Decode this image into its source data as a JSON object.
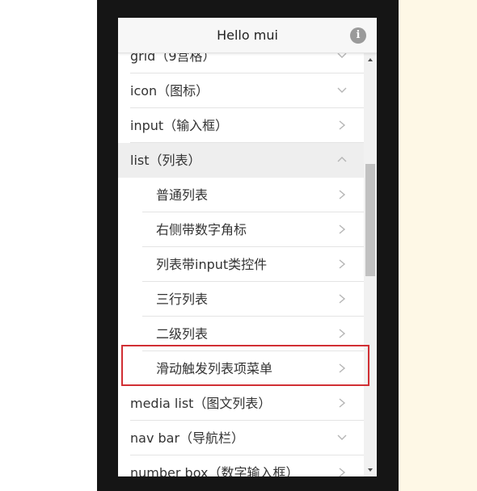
{
  "colors": {
    "phone_frame": "#151515",
    "page_right_bg": "#fef8e6",
    "highlight": "#d12f34",
    "open_row_bg": "#eeeeee"
  },
  "header": {
    "title": "Hello mui",
    "info_icon": "info-circle-icon",
    "info_glyph": "i"
  },
  "list": [
    {
      "id": "grid",
      "label": "grid（9宫格）",
      "chevron": "down",
      "type": "top"
    },
    {
      "id": "icon",
      "label": "icon（图标）",
      "chevron": "down",
      "type": "top"
    },
    {
      "id": "input",
      "label": "input（输入框）",
      "chevron": "right",
      "type": "top"
    },
    {
      "id": "list",
      "label": "list（列表）",
      "chevron": "up",
      "type": "top",
      "expanded": true
    },
    {
      "id": "list-plain",
      "label": "普通列表",
      "chevron": "right",
      "type": "sub"
    },
    {
      "id": "list-badge",
      "label": "右侧带数字角标",
      "chevron": "right",
      "type": "sub"
    },
    {
      "id": "list-input",
      "label": "列表带input类控件",
      "chevron": "right",
      "type": "sub"
    },
    {
      "id": "list-three",
      "label": "三行列表",
      "chevron": "right",
      "type": "sub"
    },
    {
      "id": "list-two",
      "label": "二级列表",
      "chevron": "right",
      "type": "sub"
    },
    {
      "id": "list-swipe",
      "label": "滑动触发列表项菜单",
      "chevron": "right",
      "type": "sub",
      "highlighted": true
    },
    {
      "id": "media-list",
      "label": "media list（图文列表）",
      "chevron": "right",
      "type": "top"
    },
    {
      "id": "nav-bar",
      "label": "nav bar（导航栏）",
      "chevron": "down",
      "type": "top"
    },
    {
      "id": "number-box",
      "label": "number box（数字输入框）",
      "chevron": "right",
      "type": "top"
    }
  ]
}
